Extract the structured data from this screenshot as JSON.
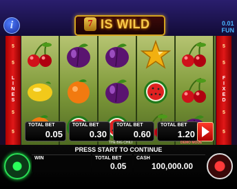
{
  "header": {
    "title_seven": "7",
    "title": "IS WILD",
    "info_icon": "i",
    "denomination_value": "0.01",
    "denomination_currency": "FUN"
  },
  "rails": {
    "left_label": "LINES",
    "right_label": "FIXED",
    "numbers": [
      "5",
      "5",
      "5",
      "5",
      "5",
      "5",
      "5",
      "5"
    ]
  },
  "reels": [
    [
      "cherry",
      "lemon",
      "orange"
    ],
    [
      "plum",
      "orange",
      "watermelon"
    ],
    [
      "plum",
      "plum",
      "watermelon"
    ],
    [
      "star",
      "watermelon",
      "cherry"
    ],
    [
      "cherry",
      "cherry",
      "plum"
    ]
  ],
  "bets": [
    {
      "label": "TOTAL BET",
      "value": "0.05"
    },
    {
      "label": "TOTAL BET",
      "value": "0.30"
    },
    {
      "label": "TOTAL BET",
      "value": "0.60"
    },
    {
      "label": "TOTAL BET",
      "value": "1.20"
    }
  ],
  "strip": {
    "game_name": "THE BIG CHILI",
    "demo_note": "DEMO MODE"
  },
  "bottom": {
    "message": "PRESS START TO CONTINUE",
    "win_label": "WIN",
    "total_bet_label": "TOTAL BET",
    "total_bet_value": "0.05",
    "cash_label": "CASH",
    "cash_value": "100,000.00"
  },
  "colors": {
    "accent_gold": "#f8c94a",
    "rail_red": "#d01010",
    "info_blue": "#2f4fd0",
    "denom_blue": "#48b5ff"
  }
}
